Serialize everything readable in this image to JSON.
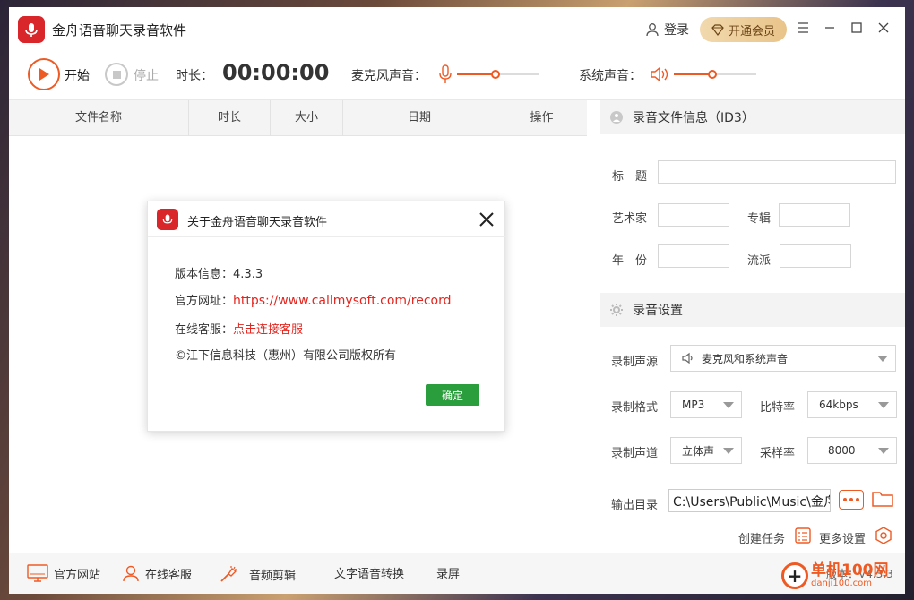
{
  "window": {
    "title": "金舟语音聊天录音软件",
    "login_label": "登录",
    "vip_label": "开通会员"
  },
  "controls": {
    "start_label": "开始",
    "stop_label": "停止",
    "duration_label": "时长：",
    "timer": "00:00:00",
    "mic_label": "麦克风声音：",
    "system_label": "系统声音：",
    "mic_volume": 0.47,
    "system_volume": 0.47,
    "accent_color": "#ee5a24"
  },
  "table": {
    "columns": [
      "文件名称",
      "时长",
      "大小",
      "日期",
      "操作"
    ]
  },
  "id3": {
    "header": "录音文件信息（ID3）",
    "title_label": "标　题",
    "artist_label": "艺术家",
    "album_label": "专辑",
    "year_label": "年　份",
    "genre_label": "流派"
  },
  "settings": {
    "header": "录音设置",
    "source_label": "录制声源",
    "source_value": "麦克风和系统声音",
    "format_label": "录制格式",
    "format_value": "MP3",
    "bitrate_label": "比特率",
    "bitrate_value": "64kbps",
    "channel_label": "录制声道",
    "channel_value": "立体声",
    "samplerate_label": "采样率",
    "samplerate_value": "8000",
    "output_label": "输出目录",
    "output_path": "C:\\Users\\Public\\Music\\金舟",
    "create_task_label": "创建任务",
    "more_settings_label": "更多设置"
  },
  "bottom": {
    "items": [
      "官方网站",
      "在线客服",
      "音频剪辑",
      "文字语音转换",
      "录屏"
    ],
    "version": "版本：V4.3.3"
  },
  "dialog": {
    "title": "关于金舟语音聊天录音软件",
    "version_label": "版本信息：",
    "version_value": "4.3.3",
    "site_label": "官方网址：",
    "site_value": "https://www.callmysoft.com/record",
    "service_label": "在线客服：",
    "service_value": "点击连接客服",
    "copyright": "©江下信息科技（惠州）有限公司版权所有",
    "ok_label": "确定"
  },
  "watermark": {
    "text": "单机100网",
    "sub": "danji100.com"
  }
}
